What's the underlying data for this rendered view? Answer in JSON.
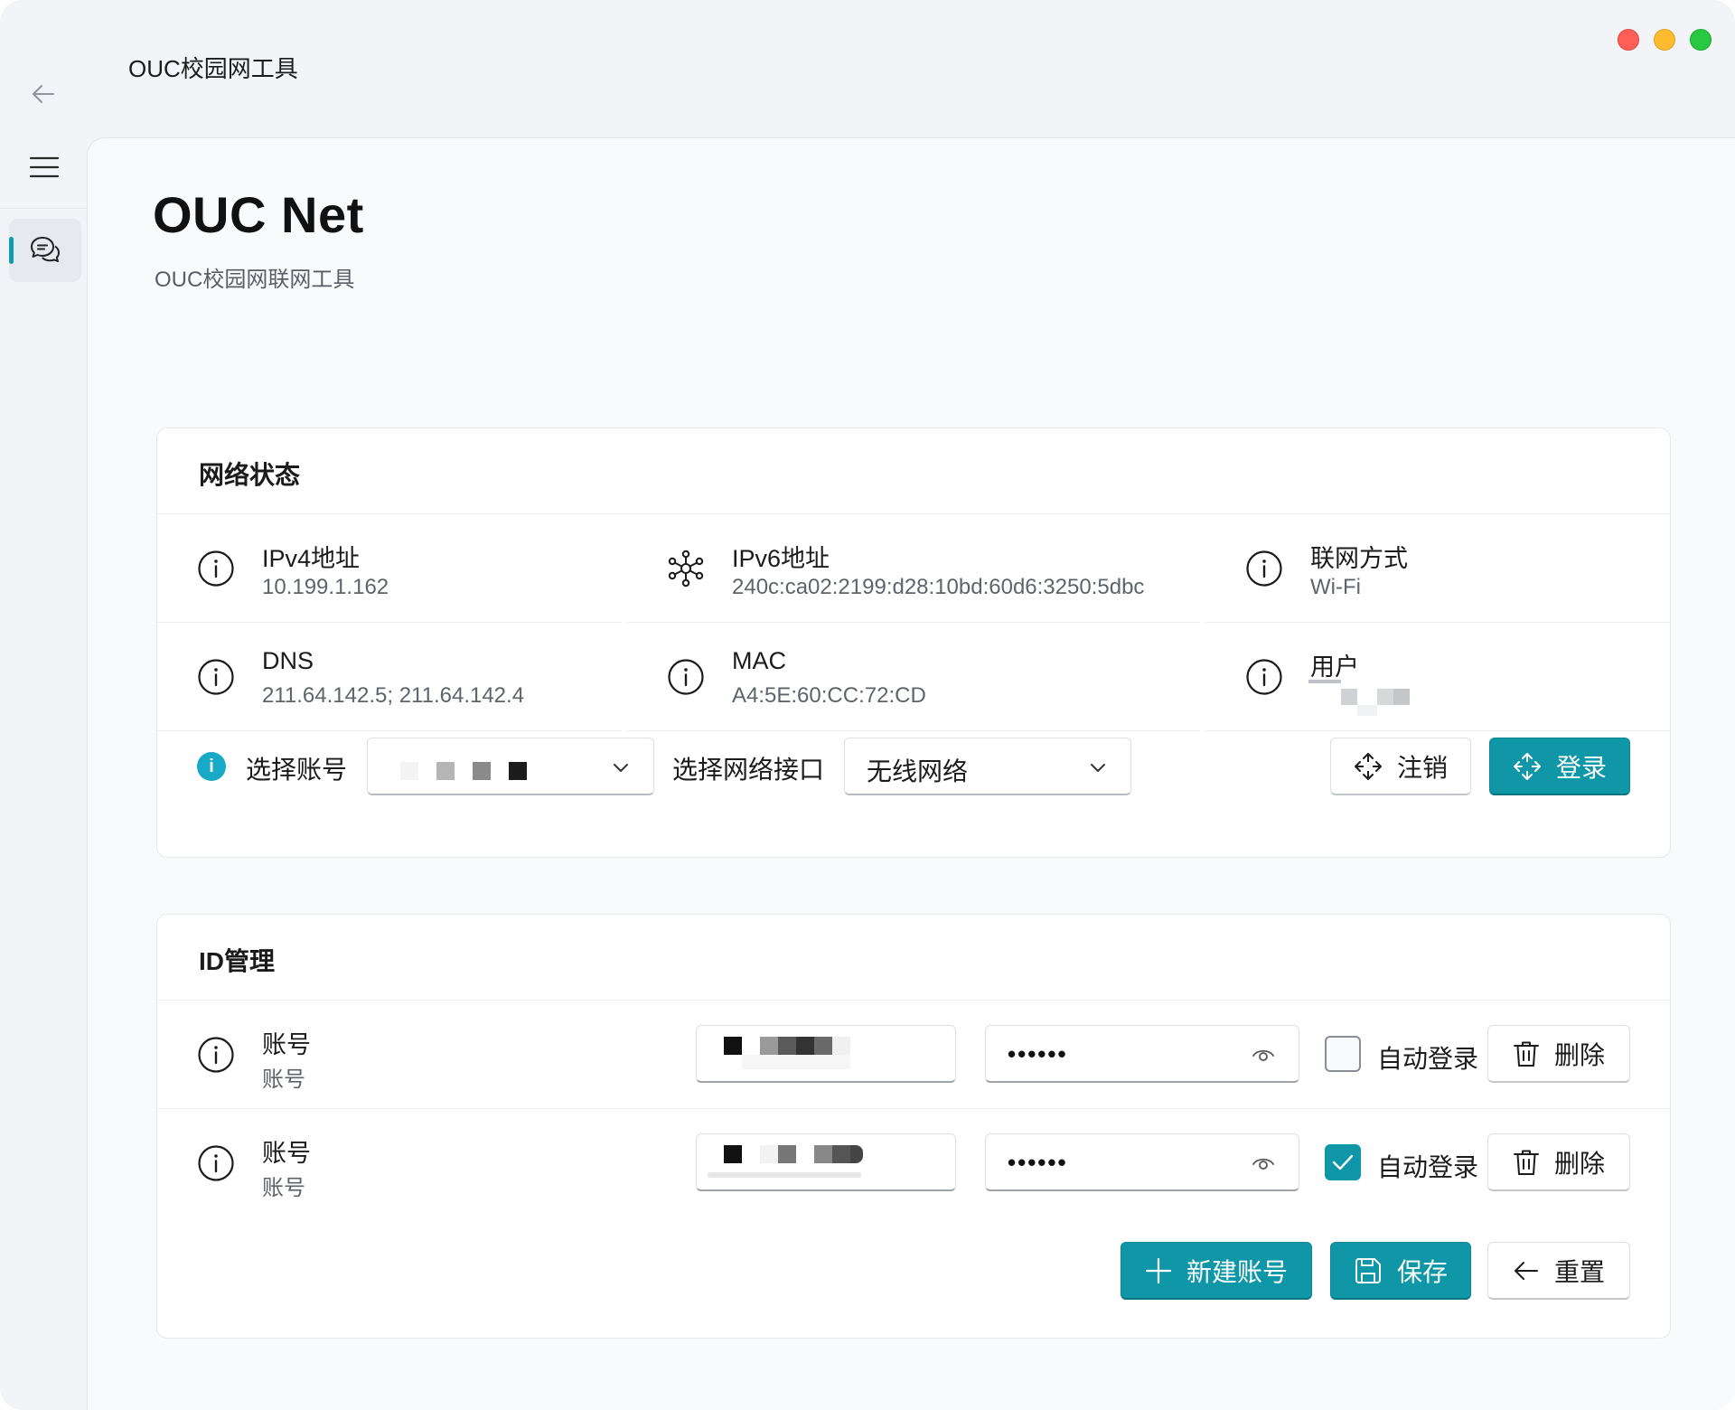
{
  "window": {
    "title": "OUC校园网工具",
    "traffic_lights": [
      "#ff5f57",
      "#febc2e",
      "#28c840"
    ]
  },
  "sidebar": {
    "items": [
      {
        "name": "back",
        "icon": "arrow-left-icon"
      },
      {
        "name": "menu",
        "icon": "hamburger-icon"
      },
      {
        "name": "chat",
        "icon": "chat-bubbles-icon",
        "selected": true
      }
    ],
    "accent": "#0f9bb0"
  },
  "page": {
    "title": "OUC Net",
    "subtitle": "OUC校园网联网工具"
  },
  "network_status": {
    "title": "网络状态",
    "items": [
      {
        "label": "IPv4地址",
        "value": "10.199.1.162",
        "icon": "info-icon"
      },
      {
        "label": "IPv6地址",
        "value": "240c:ca02:2199:d28:10bd:60d6:3250:5dbc",
        "icon": "network-hub-icon"
      },
      {
        "label": "联网方式",
        "value": "Wi-Fi",
        "icon": "info-icon"
      },
      {
        "label": "DNS",
        "value": "211.64.142.5; 211.64.142.4",
        "icon": "info-icon"
      },
      {
        "label": "MAC",
        "value": "A4:5E:60:CC:72:CD",
        "icon": "info-icon"
      },
      {
        "label": "用户",
        "value": "",
        "icon": "info-icon"
      }
    ],
    "controls": {
      "account_label": "选择账号",
      "account_value": "",
      "interface_label": "选择网络接口",
      "interface_value": "无线网络",
      "logout_label": "注销",
      "login_label": "登录"
    }
  },
  "id_management": {
    "title": "ID管理",
    "accounts": [
      {
        "title": "账号",
        "subtitle": "账号",
        "password_mask": "••••••",
        "auto_login": false,
        "auto_login_label": "自动登录",
        "delete_label": "删除"
      },
      {
        "title": "账号",
        "subtitle": "账号",
        "password_mask": "••••••",
        "auto_login": true,
        "auto_login_label": "自动登录",
        "delete_label": "删除"
      }
    ],
    "actions": {
      "new_label": "新建账号",
      "save_label": "保存",
      "reset_label": "重置"
    }
  },
  "colors": {
    "primary": "#1097a7",
    "info_dot": "#18a9c6"
  }
}
